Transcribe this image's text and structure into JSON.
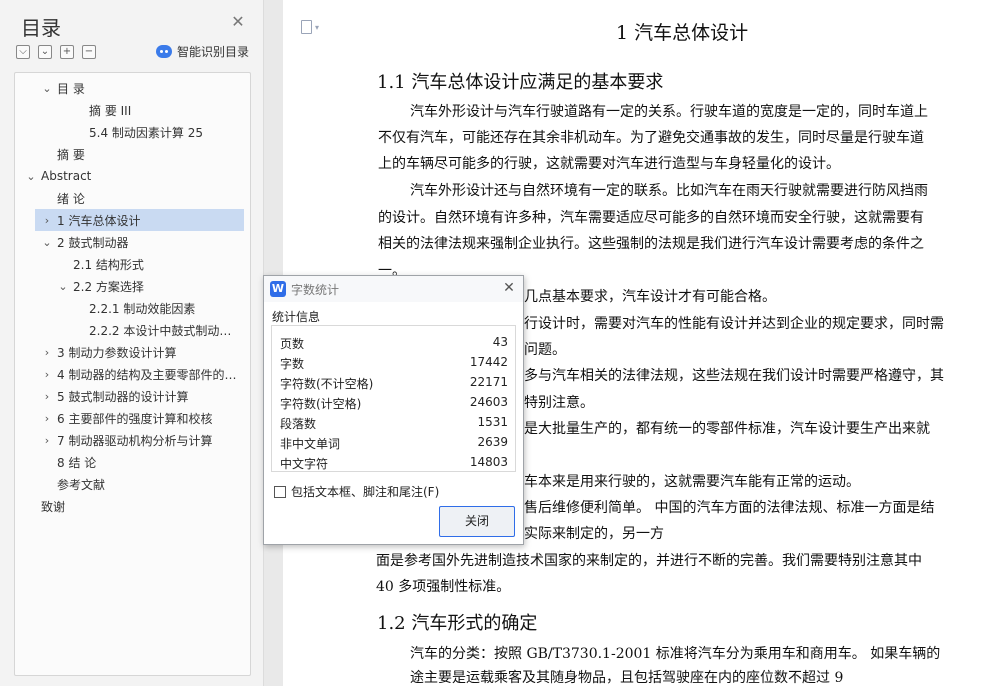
{
  "nav": {
    "title": "目录",
    "smart_toc_label": "智能识别目录",
    "tool_icons": [
      "collapse-all-icon",
      "expand-level-icon",
      "add-heading-icon",
      "remove-heading-icon"
    ],
    "items": [
      {
        "label": "目 录",
        "level": 1,
        "caret": "⌵"
      },
      {
        "label": "摘 要 III",
        "level": 3,
        "caret": ""
      },
      {
        "label": "5.4 制动因素计算 25",
        "level": 3,
        "caret": ""
      },
      {
        "label": "摘 要",
        "level": 1,
        "caret": ""
      },
      {
        "label": "Abstract",
        "level": 0,
        "caret": "⌵"
      },
      {
        "label": "绪 论",
        "level": 1,
        "caret": ""
      },
      {
        "label": "1  汽车总体设计",
        "level": 1,
        "caret": "›",
        "selected": true
      },
      {
        "label": "2  鼓式制动器",
        "level": 1,
        "caret": "⌵"
      },
      {
        "label": "2.1 结构形式",
        "level": 2,
        "caret": ""
      },
      {
        "label": "2.2 方案选择",
        "level": 2,
        "caret": "⌵"
      },
      {
        "label": "2.2.1 制动效能因素",
        "level": 3,
        "caret": ""
      },
      {
        "label": "2.2.2 本设计中鼓式制动…",
        "level": 3,
        "caret": ""
      },
      {
        "label": "3  制动力参数设计计算",
        "level": 1,
        "caret": "›"
      },
      {
        "label": "4  制动器的结构及主要零部件的…",
        "level": 1,
        "caret": "›"
      },
      {
        "label": "5  鼓式制动器的设计计算",
        "level": 1,
        "caret": "›"
      },
      {
        "label": "6  主要部件的强度计算和校核",
        "level": 1,
        "caret": "›"
      },
      {
        "label": "7  制动器驱动机构分析与计算",
        "level": 1,
        "caret": "›"
      },
      {
        "label": "8  结 论",
        "level": 1,
        "caret": ""
      },
      {
        "label": "参考文献",
        "level": 1,
        "caret": ""
      },
      {
        "label": "致谢",
        "level": 0,
        "caret": ""
      }
    ]
  },
  "doc": {
    "chapter_title": "1  汽车总体设计",
    "section_1_1": "1.1 汽车总体设计应满足的基本要求",
    "section_1_2": "1.2  汽车形式的确定",
    "lines": [
      "汽车外形设计与汽车行驶道路有一定的关系。行驶车道的宽度是一定的，同时车道上",
      "不仅有汽车，可能还存在其余非机动车。为了避免交通事故的发生，同时尽量是行驶车道",
      "上的车辆尽可能多的行驶，这就需要对汽车进行造型与车身轻量化的设计。",
      "汽车外形设计还与自然环境有一定的联系。比如汽车在雨天行驶就需要进行防风挡雨",
      "的设计。自然环境有许多种，汽车需要适应尽可能多的自然环境而安全行驶，这就需要有",
      "相关的法律法规来强制企业执行。这些强制的法规是我们进行汽车设计需要考虑的条件之",
      "一。",
      "几点基本要求，汽车设计才有可能合格。",
      "行设计时，需要对汽车的性能有设计并达到企业的规定要求，同时需",
      "问题。",
      "多与汽车相关的法律法规，这些法规在我们设计时需要严格遵守，其",
      "特别注意。",
      "都是大批量生产的，都有统一的零部件标准，汽车设计要生产出来就",
      "汽车本来是用来行驶的，这就需要汽车能有正常的运动。",
      "售后维修便利简单。 中国的汽车方面的法律法规、标准一方面是结",
      "实际来制定的，另一方",
      "面是参考国外先进制造技术国家的来制定的，并进行不断的完善。我们需要特别注意其中",
      "40 多项强制性标准。",
      "汽车的分类：按照 GB/T3730.1-2001 标准将汽车分为乘用车和商用车。  如果车辆的",
      "途主要是运载乘客及其随身物品，且包括驾驶座在内的座位数不超过 9"
    ]
  },
  "dialog": {
    "title": "字数统计",
    "section": "统计信息",
    "stats": [
      {
        "label": "页数",
        "value": "43"
      },
      {
        "label": "字数",
        "value": "17442"
      },
      {
        "label": "字符数(不计空格)",
        "value": "22171"
      },
      {
        "label": "字符数(计空格)",
        "value": "24603"
      },
      {
        "label": "段落数",
        "value": "1531"
      },
      {
        "label": "非中文单词",
        "value": "2639"
      },
      {
        "label": "中文字符",
        "value": "14803"
      }
    ],
    "include_label": "包括文本框、脚注和尾注(F)",
    "include_checked": false,
    "close_label": "关闭"
  }
}
